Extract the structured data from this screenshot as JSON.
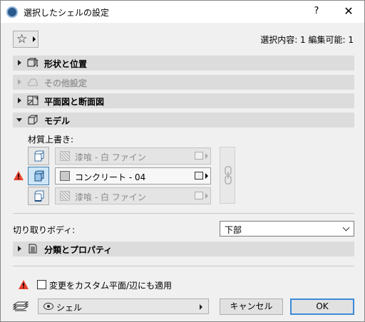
{
  "window": {
    "title": "選択したシェルの設定",
    "help": "?",
    "close": "✕"
  },
  "toolbar": {
    "favorites_icon": "star-icon",
    "selection_info": "選択内容: 1 編集可能: 1"
  },
  "sections": [
    {
      "label": "形状と位置",
      "icon": "geometry-icon",
      "expanded": false,
      "enabled": true
    },
    {
      "label": "その他設定",
      "icon": "cloud-icon",
      "expanded": false,
      "enabled": false
    },
    {
      "label": "平面図と断面図",
      "icon": "floorplan-icon",
      "expanded": false,
      "enabled": true
    },
    {
      "label": "モデル",
      "icon": "model-icon",
      "expanded": true,
      "enabled": true
    },
    {
      "label": "分類とプロパティ",
      "icon": "document-icon",
      "expanded": false,
      "enabled": true
    }
  ],
  "model": {
    "override_label": "材質上書き:",
    "materials": [
      {
        "name": "漆喰 - 白 ファイン",
        "active": false
      },
      {
        "name": "コンクリート - 04",
        "active": true
      },
      {
        "name": "漆喰 - 白 ファイン",
        "active": false
      }
    ]
  },
  "cut_body": {
    "label": "切り取りボディ:",
    "value": "下部"
  },
  "apply_checkbox": {
    "label": "変更をカスタム平面/辺にも適用",
    "checked": false
  },
  "footer": {
    "layer_label": "シェル",
    "cancel": "キャンセル",
    "ok": "OK"
  },
  "colors": {
    "warning": "#e8432e",
    "ok_border": "#3c8ad9",
    "active_tool": "#cde6f7"
  }
}
